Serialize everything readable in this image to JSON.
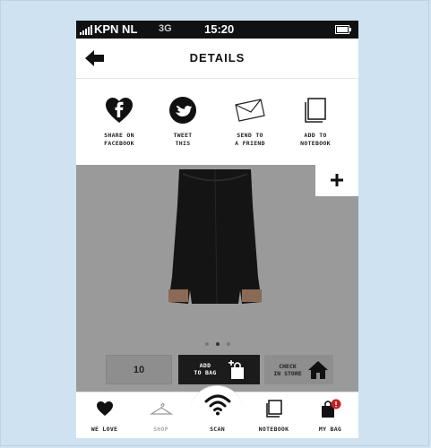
{
  "statusbar": {
    "carrier": "KPN NL",
    "network": "3G",
    "time": "15:20"
  },
  "navbar": {
    "title": "DETAILS"
  },
  "share": {
    "facebook": [
      "SHARE ON",
      "FACEBOOK"
    ],
    "tweet": [
      "TWEET",
      "THIS"
    ],
    "friend": [
      "SEND TO",
      "A FRIEND"
    ],
    "notebook": [
      "ADD TO",
      "NOTEBOOK"
    ]
  },
  "product": {
    "gallery_pages": 3,
    "gallery_active": 2
  },
  "actions": {
    "quantity": "10",
    "add_to_bag": [
      "ADD",
      "TO BAG"
    ],
    "check_in_store": [
      "CHECK",
      "IN STORE"
    ]
  },
  "tabs": {
    "we_love": "WE LOVE",
    "shop": "SHOP",
    "scan": "SCAN",
    "notebook": "NOTEBOOK",
    "my_bag": "MY BAG"
  },
  "colors": {
    "accent_badge": "#cc1f1f",
    "product_bg": "#9a9a9a",
    "dark_button": "#1b1b1b"
  }
}
